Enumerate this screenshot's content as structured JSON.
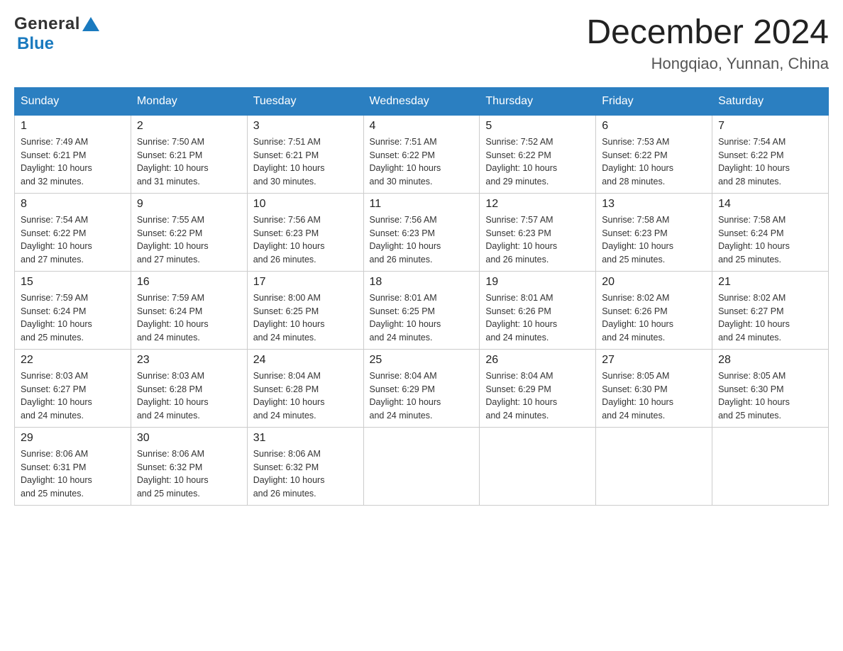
{
  "header": {
    "logo_general": "General",
    "logo_blue": "Blue",
    "month_title": "December 2024",
    "location": "Hongqiao, Yunnan, China"
  },
  "columns": [
    "Sunday",
    "Monday",
    "Tuesday",
    "Wednesday",
    "Thursday",
    "Friday",
    "Saturday"
  ],
  "weeks": [
    [
      {
        "day": "1",
        "info": "Sunrise: 7:49 AM\nSunset: 6:21 PM\nDaylight: 10 hours\nand 32 minutes."
      },
      {
        "day": "2",
        "info": "Sunrise: 7:50 AM\nSunset: 6:21 PM\nDaylight: 10 hours\nand 31 minutes."
      },
      {
        "day": "3",
        "info": "Sunrise: 7:51 AM\nSunset: 6:21 PM\nDaylight: 10 hours\nand 30 minutes."
      },
      {
        "day": "4",
        "info": "Sunrise: 7:51 AM\nSunset: 6:22 PM\nDaylight: 10 hours\nand 30 minutes."
      },
      {
        "day": "5",
        "info": "Sunrise: 7:52 AM\nSunset: 6:22 PM\nDaylight: 10 hours\nand 29 minutes."
      },
      {
        "day": "6",
        "info": "Sunrise: 7:53 AM\nSunset: 6:22 PM\nDaylight: 10 hours\nand 28 minutes."
      },
      {
        "day": "7",
        "info": "Sunrise: 7:54 AM\nSunset: 6:22 PM\nDaylight: 10 hours\nand 28 minutes."
      }
    ],
    [
      {
        "day": "8",
        "info": "Sunrise: 7:54 AM\nSunset: 6:22 PM\nDaylight: 10 hours\nand 27 minutes."
      },
      {
        "day": "9",
        "info": "Sunrise: 7:55 AM\nSunset: 6:22 PM\nDaylight: 10 hours\nand 27 minutes."
      },
      {
        "day": "10",
        "info": "Sunrise: 7:56 AM\nSunset: 6:23 PM\nDaylight: 10 hours\nand 26 minutes."
      },
      {
        "day": "11",
        "info": "Sunrise: 7:56 AM\nSunset: 6:23 PM\nDaylight: 10 hours\nand 26 minutes."
      },
      {
        "day": "12",
        "info": "Sunrise: 7:57 AM\nSunset: 6:23 PM\nDaylight: 10 hours\nand 26 minutes."
      },
      {
        "day": "13",
        "info": "Sunrise: 7:58 AM\nSunset: 6:23 PM\nDaylight: 10 hours\nand 25 minutes."
      },
      {
        "day": "14",
        "info": "Sunrise: 7:58 AM\nSunset: 6:24 PM\nDaylight: 10 hours\nand 25 minutes."
      }
    ],
    [
      {
        "day": "15",
        "info": "Sunrise: 7:59 AM\nSunset: 6:24 PM\nDaylight: 10 hours\nand 25 minutes."
      },
      {
        "day": "16",
        "info": "Sunrise: 7:59 AM\nSunset: 6:24 PM\nDaylight: 10 hours\nand 24 minutes."
      },
      {
        "day": "17",
        "info": "Sunrise: 8:00 AM\nSunset: 6:25 PM\nDaylight: 10 hours\nand 24 minutes."
      },
      {
        "day": "18",
        "info": "Sunrise: 8:01 AM\nSunset: 6:25 PM\nDaylight: 10 hours\nand 24 minutes."
      },
      {
        "day": "19",
        "info": "Sunrise: 8:01 AM\nSunset: 6:26 PM\nDaylight: 10 hours\nand 24 minutes."
      },
      {
        "day": "20",
        "info": "Sunrise: 8:02 AM\nSunset: 6:26 PM\nDaylight: 10 hours\nand 24 minutes."
      },
      {
        "day": "21",
        "info": "Sunrise: 8:02 AM\nSunset: 6:27 PM\nDaylight: 10 hours\nand 24 minutes."
      }
    ],
    [
      {
        "day": "22",
        "info": "Sunrise: 8:03 AM\nSunset: 6:27 PM\nDaylight: 10 hours\nand 24 minutes."
      },
      {
        "day": "23",
        "info": "Sunrise: 8:03 AM\nSunset: 6:28 PM\nDaylight: 10 hours\nand 24 minutes."
      },
      {
        "day": "24",
        "info": "Sunrise: 8:04 AM\nSunset: 6:28 PM\nDaylight: 10 hours\nand 24 minutes."
      },
      {
        "day": "25",
        "info": "Sunrise: 8:04 AM\nSunset: 6:29 PM\nDaylight: 10 hours\nand 24 minutes."
      },
      {
        "day": "26",
        "info": "Sunrise: 8:04 AM\nSunset: 6:29 PM\nDaylight: 10 hours\nand 24 minutes."
      },
      {
        "day": "27",
        "info": "Sunrise: 8:05 AM\nSunset: 6:30 PM\nDaylight: 10 hours\nand 24 minutes."
      },
      {
        "day": "28",
        "info": "Sunrise: 8:05 AM\nSunset: 6:30 PM\nDaylight: 10 hours\nand 25 minutes."
      }
    ],
    [
      {
        "day": "29",
        "info": "Sunrise: 8:06 AM\nSunset: 6:31 PM\nDaylight: 10 hours\nand 25 minutes."
      },
      {
        "day": "30",
        "info": "Sunrise: 8:06 AM\nSunset: 6:32 PM\nDaylight: 10 hours\nand 25 minutes."
      },
      {
        "day": "31",
        "info": "Sunrise: 8:06 AM\nSunset: 6:32 PM\nDaylight: 10 hours\nand 26 minutes."
      },
      null,
      null,
      null,
      null
    ]
  ]
}
